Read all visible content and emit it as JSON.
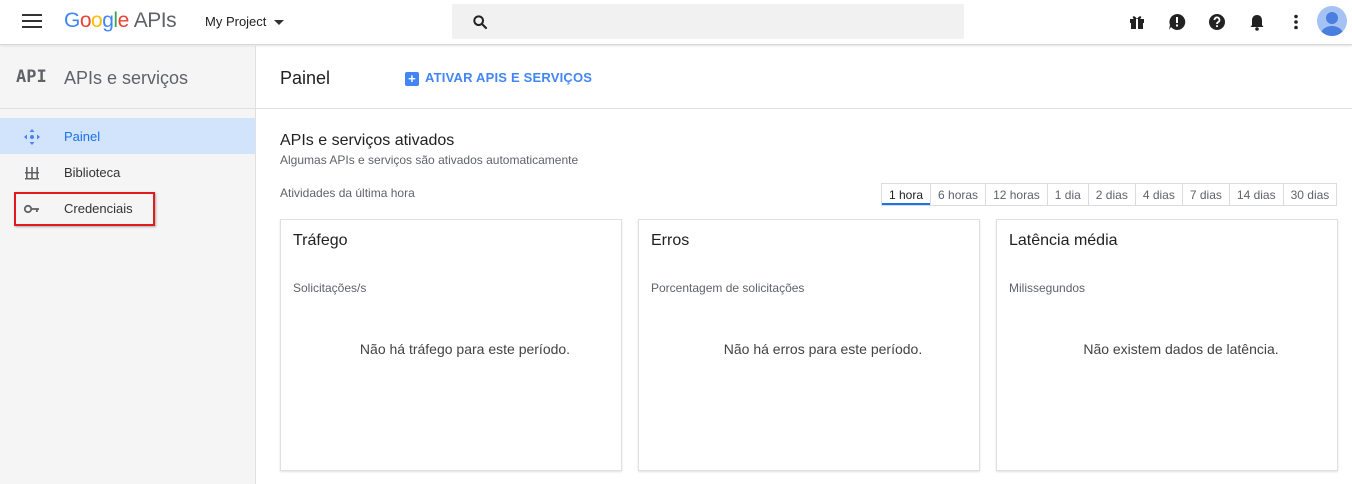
{
  "topbar": {
    "logo_google": "Google",
    "logo_apis": "APIs",
    "project": "My Project",
    "icons": [
      "menu-icon",
      "search-icon",
      "gift-icon",
      "feedback-icon",
      "help-icon",
      "notifications-icon",
      "more-vert-icon",
      "avatar"
    ]
  },
  "sidebar": {
    "logo": "API",
    "title": "APIs e serviços",
    "items": [
      {
        "label": "Painel",
        "icon": "dashboard-icon",
        "active": true
      },
      {
        "label": "Biblioteca",
        "icon": "library-icon",
        "active": false
      },
      {
        "label": "Credenciais",
        "icon": "key-icon",
        "active": false
      }
    ]
  },
  "main": {
    "title": "Painel",
    "enable_button": "ATIVAR APIS E SERVIÇOS",
    "section_title": "APIs e serviços ativados",
    "section_sub": "Algumas APIs e serviços são ativados automaticamente",
    "activity_label": "Atividades da última hora",
    "time_ranges": [
      "1 hora",
      "6 horas",
      "12 horas",
      "1 dia",
      "2 dias",
      "4 dias",
      "7 dias",
      "14 dias",
      "30 dias"
    ],
    "selected_range": "1 hora",
    "cards": [
      {
        "title": "Tráfego",
        "sub": "Solicitações/s",
        "empty": "Não há tráfego para este período."
      },
      {
        "title": "Erros",
        "sub": "Porcentagem de solicitações",
        "empty": "Não há erros para este período."
      },
      {
        "title": "Latência média",
        "sub": "Milissegundos",
        "empty": "Não existem dados de latência."
      }
    ]
  },
  "colors": {
    "accent": "#4285f4",
    "active_bg": "#d2e3fc",
    "highlight": "#e01b1b"
  }
}
